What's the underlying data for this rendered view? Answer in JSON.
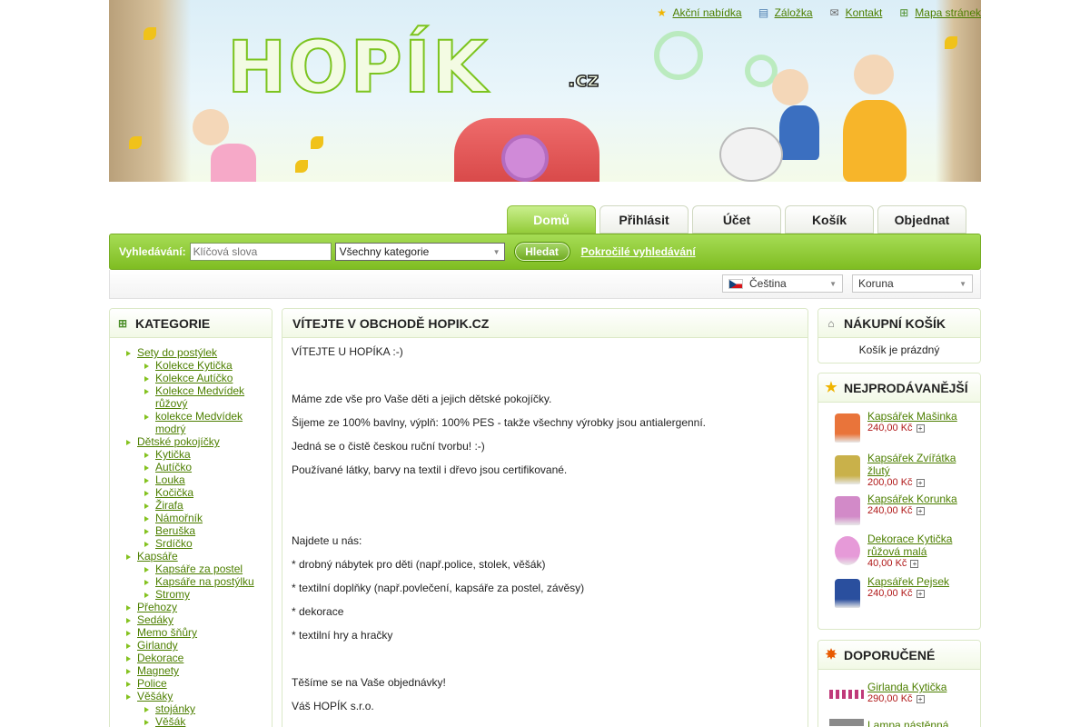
{
  "header": {
    "logo_text": "HOPÍK",
    "logo_suffix": ".cz",
    "top_links": [
      {
        "label": "Akční nabídka",
        "icon": "star-icon"
      },
      {
        "label": "Záložka",
        "icon": "bookmark-icon"
      },
      {
        "label": "Kontakt",
        "icon": "envelope-icon"
      },
      {
        "label": "Mapa stránek",
        "icon": "sitemap-icon"
      }
    ]
  },
  "tabs": [
    "Domů",
    "Přihlásit",
    "Účet",
    "Košík",
    "Objednat"
  ],
  "search": {
    "label": "Vyhledávání:",
    "placeholder": "Klíčová slova",
    "category_selected": "Všechny kategorie",
    "button": "Hledat",
    "advanced_link": "Pokročilé vyhledávání"
  },
  "locale": {
    "language": "Čeština",
    "currency": "Koruna"
  },
  "categories": {
    "title": "KATEGORIE",
    "items": [
      {
        "label": "Sety do postýlek",
        "level": 0
      },
      {
        "label": "Kolekce Kytička",
        "level": 1
      },
      {
        "label": "Kolekce Autíčko",
        "level": 1
      },
      {
        "label": "Kolekce Medvídek růžový",
        "level": 1
      },
      {
        "label": "kolekce Medvídek modrý",
        "level": 1
      },
      {
        "label": "Dětské pokojíčky",
        "level": 0
      },
      {
        "label": "Kytička",
        "level": 1
      },
      {
        "label": "Autíčko",
        "level": 1
      },
      {
        "label": "Louka",
        "level": 1
      },
      {
        "label": "Kočička",
        "level": 1
      },
      {
        "label": "Žirafa",
        "level": 1
      },
      {
        "label": "Námořník",
        "level": 1
      },
      {
        "label": "Beruška",
        "level": 1
      },
      {
        "label": "Srdíčko",
        "level": 1
      },
      {
        "label": "Kapsáře",
        "level": 0
      },
      {
        "label": "Kapsáře za postel",
        "level": 1
      },
      {
        "label": "Kapsáře na postýlku",
        "level": 1
      },
      {
        "label": "Stromy",
        "level": 1
      },
      {
        "label": "Přehozy",
        "level": 0
      },
      {
        "label": "Sedáky",
        "level": 0
      },
      {
        "label": "Memo šňůry",
        "level": 0
      },
      {
        "label": "Girlandy",
        "level": 0
      },
      {
        "label": "Dekorace",
        "level": 0
      },
      {
        "label": "Magnety",
        "level": 0
      },
      {
        "label": "Police",
        "level": 0
      },
      {
        "label": "Věšáky",
        "level": 0
      },
      {
        "label": "stojánky",
        "level": 1
      },
      {
        "label": "Věšák",
        "level": 1
      }
    ]
  },
  "main": {
    "title": "VÍTEJTE V OBCHODĚ HOPIK.CZ",
    "paragraphs": [
      "VÍTEJTE U HOPÍKA :-)",
      "",
      "Máme zde vše pro Vaše děti a jejich dětské pokojíčky.",
      "Šijeme ze 100% bavlny, výplň: 100% PES - takže všechny výrobky jsou antialergenní.",
      "Jedná se o čistě českou ruční tvorbu! :-)",
      "Používané látky, barvy na textil i dřevo jsou certifikované.",
      "",
      "",
      "Najdete u nás:",
      "* drobný nábytek pro děti (např.police, stolek, věšák)",
      "* textilní doplňky (např.povlečení, kapsáře za postel, závěsy)",
      "* dekorace",
      "* textilní hry a hračky",
      "",
      "Těšíme se na Vaše objednávky!",
      "Váš HOPÍK s.r.o."
    ]
  },
  "cart": {
    "title": "NÁKUPNÍ KOŠÍK",
    "empty_text": "Košík je prázdný"
  },
  "bestsellers": {
    "title": "NEJPRODÁVANĚJŠÍ",
    "items": [
      {
        "name": "Kapsářek Mašinka",
        "price": "240,00 Kč",
        "color": "#e9743a"
      },
      {
        "name": "Kapsářek Zvířátka žlutý",
        "price": "200,00 Kč",
        "color": "#c9b14a"
      },
      {
        "name": "Kapsářek Korunka",
        "price": "240,00 Kč",
        "color": "#d28ac8"
      },
      {
        "name": "Dekorace Kytička růžová malá",
        "price": "40,00 Kč",
        "color": "#e69ad8"
      },
      {
        "name": "Kapsářek Pejsek",
        "price": "240,00 Kč",
        "color": "#2a4f9e"
      }
    ]
  },
  "recommended": {
    "title": "DOPORUČENÉ",
    "items": [
      {
        "name": "Girlanda Kytička",
        "price": "290,00 Kč"
      },
      {
        "name": "Lampa nástěnná",
        "price": ""
      }
    ]
  },
  "colors": {
    "accent_green": "#84c21f",
    "link_green": "#4d7f00",
    "price_red": "#b01818"
  }
}
